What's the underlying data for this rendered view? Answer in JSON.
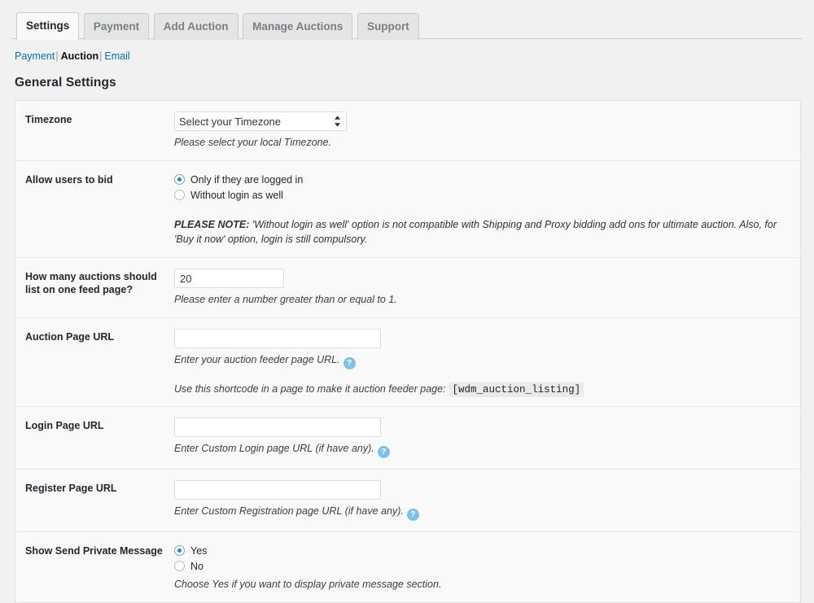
{
  "tabs": [
    {
      "label": "Settings",
      "active": true
    },
    {
      "label": "Payment",
      "active": false
    },
    {
      "label": "Add Auction",
      "active": false
    },
    {
      "label": "Manage Auctions",
      "active": false
    },
    {
      "label": "Support",
      "active": false
    }
  ],
  "subnav": {
    "payment": "Payment",
    "auction": "Auction",
    "email": "Email",
    "separator": "|"
  },
  "page_title": "General Settings",
  "rows": {
    "timezone": {
      "label": "Timezone",
      "selected_option": "Select your Timezone",
      "description": "Please select your local Timezone."
    },
    "allow_bid": {
      "label": "Allow users to bid",
      "option_logged_in": "Only if they are logged in",
      "option_without_login": "Without login as well",
      "note_strong": "PLEASE NOTE:",
      "note_text": " 'Without login as well' option is not compatible with Shipping and Proxy bidding add ons for ultimate auction. Also, for 'Buy it now' option, login is still compulsory."
    },
    "feed_count": {
      "label": "How many auctions should list on one feed page?",
      "value": "20",
      "description": "Please enter a number greater than or equal to 1."
    },
    "auction_page_url": {
      "label": "Auction Page URL",
      "value": "",
      "description": "Enter your auction feeder page URL.",
      "help_icon": "?",
      "shortcode_text": "Use this shortcode in a page to make it auction feeder page:",
      "shortcode": "[wdm_auction_listing]"
    },
    "login_page_url": {
      "label": "Login Page URL",
      "value": "",
      "description": "Enter Custom Login page URL (if have any).",
      "help_icon": "?"
    },
    "register_page_url": {
      "label": "Register Page URL",
      "value": "",
      "description": "Enter Custom Registration page URL (if have any).",
      "help_icon": "?"
    },
    "private_message": {
      "label": "Show Send Private Message",
      "option_yes": "Yes",
      "option_no": "No",
      "description": "Choose Yes if you want to display private message section."
    }
  },
  "colors": {
    "link": "#0073aa",
    "help_icon_bg": "#7ec1e8",
    "radio_dot": "#1e8cbe",
    "page_bg": "#f1f1f1",
    "panel_bg": "#f9f9f9"
  }
}
